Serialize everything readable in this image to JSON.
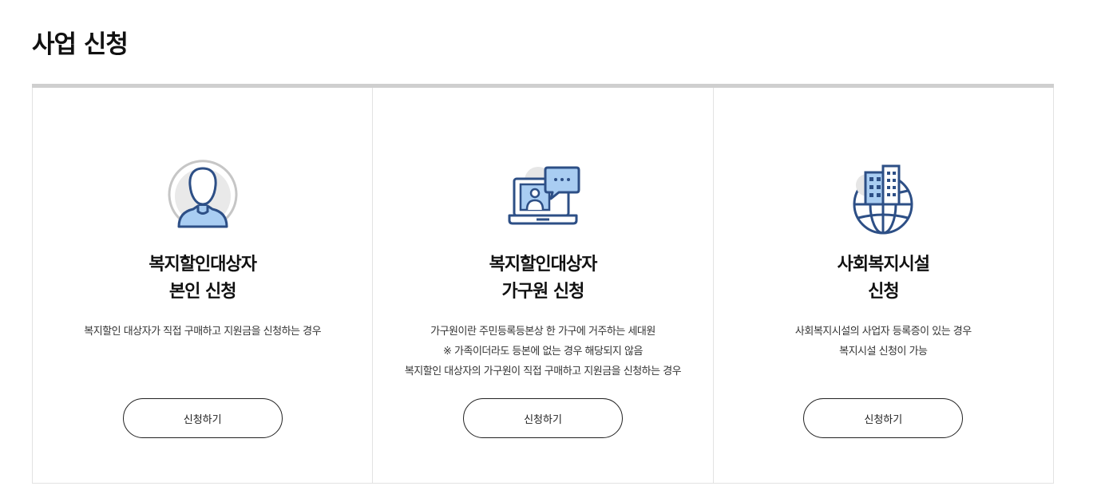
{
  "page": {
    "title": "사업 신청"
  },
  "cards": [
    {
      "icon": "person-icon",
      "title_line1": "복지할인대상자",
      "title_line2": "본인 신청",
      "desc": [
        "복지할인 대상자가 직접 구매하고 지원금을 신청하는 경우"
      ],
      "button_label": "신청하기"
    },
    {
      "icon": "laptop-chat-icon",
      "title_line1": "복지할인대상자",
      "title_line2": "가구원 신청",
      "desc": [
        "가구원이란 주민등록등본상 한 가구에 거주하는 세대원",
        "※ 가족이더라도 등본에 없는 경우 해당되지 않음",
        "복지할인 대상자의 가구원이 직접 구매하고 지원금을 신청하는 경우"
      ],
      "button_label": "신청하기"
    },
    {
      "icon": "building-globe-icon",
      "title_line1": "사회복지시설",
      "title_line2": "신청",
      "desc": [
        "사회복지시설의 사업자 등록증이 있는 경우",
        "복지시설 신청이 가능"
      ],
      "button_label": "신청하기"
    }
  ],
  "colors": {
    "icon_stroke": "#2d4f86",
    "icon_fill": "#a9cdf2",
    "icon_gray": "#e6e6e6",
    "top_border": "#cfcfcf"
  }
}
